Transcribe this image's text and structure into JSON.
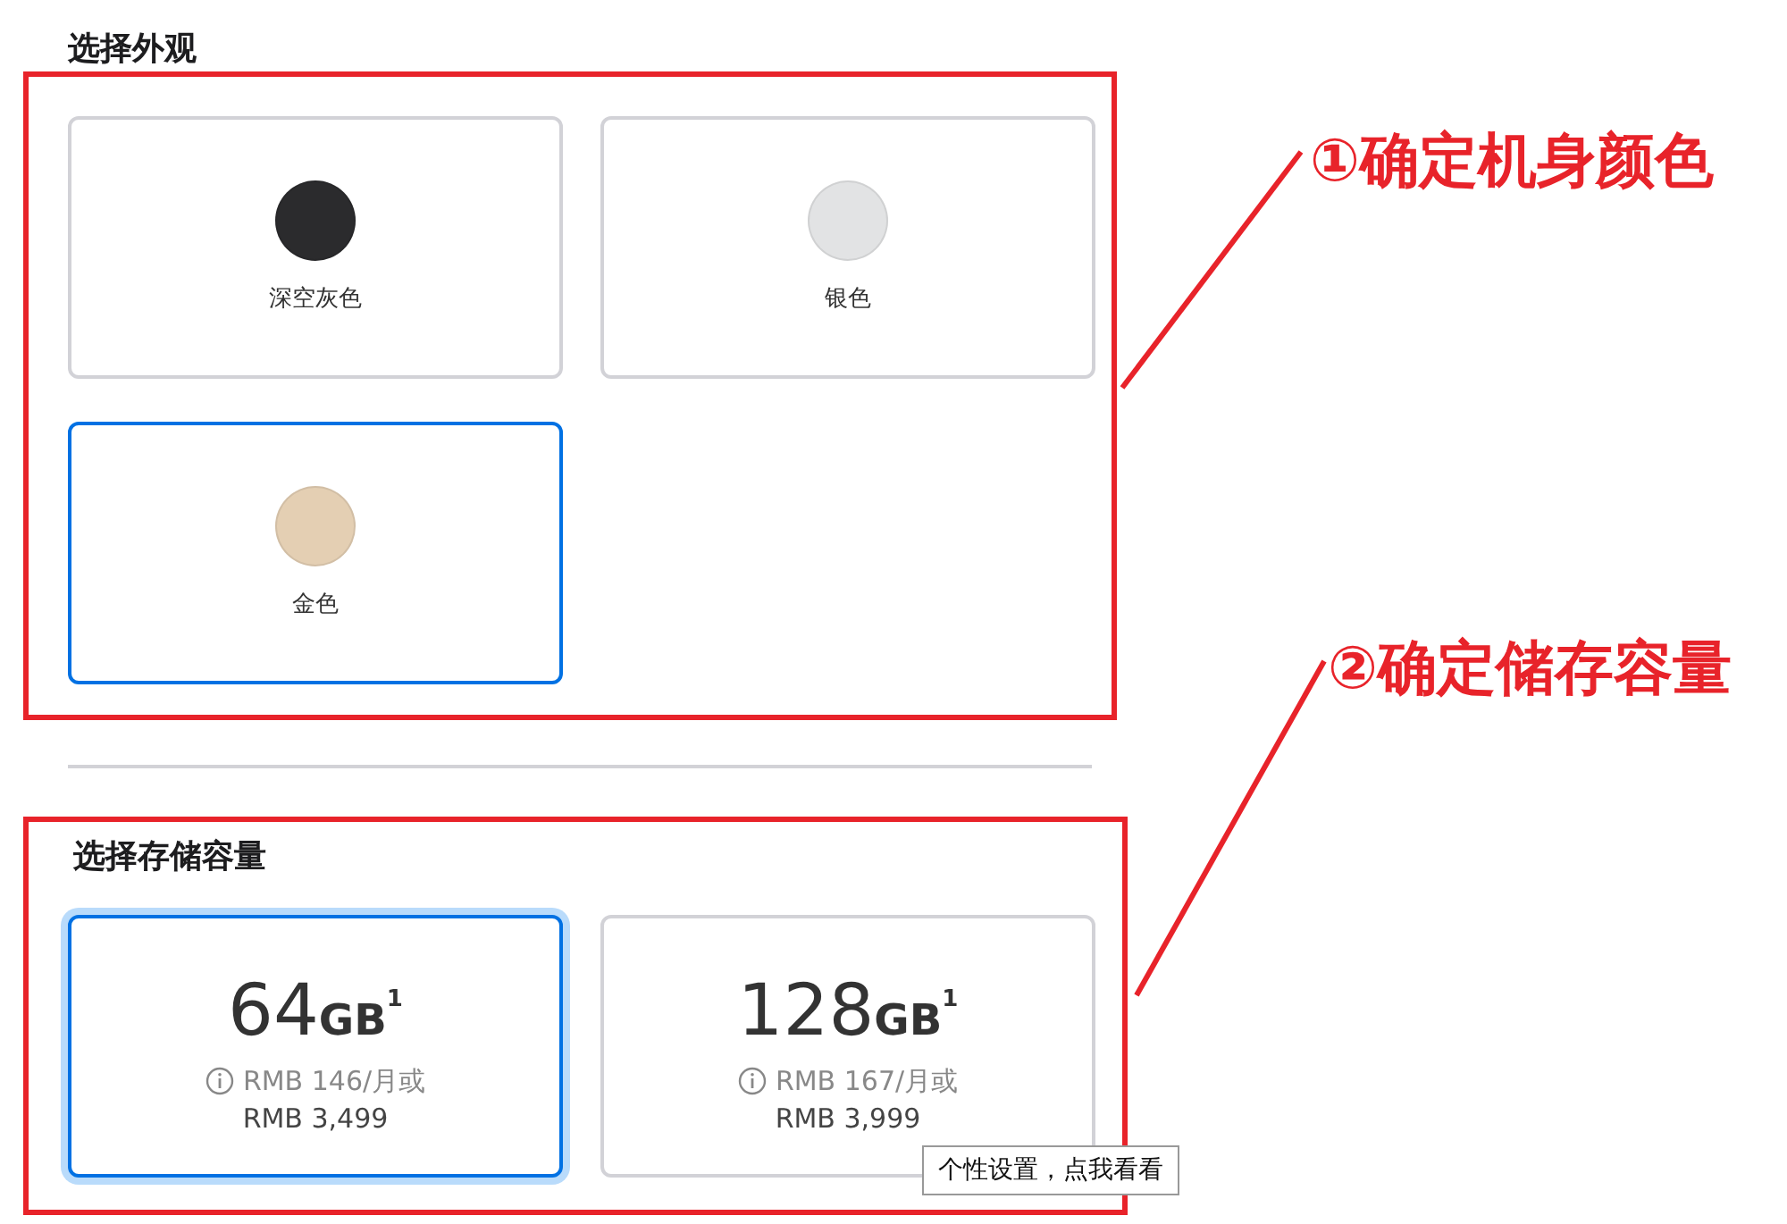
{
  "appearance": {
    "title": "选择外观",
    "options": [
      {
        "label": "深空灰色",
        "color": "#2b2b2d",
        "selected": false
      },
      {
        "label": "银色",
        "color": "#e2e3e4",
        "selected": false
      },
      {
        "label": "金色",
        "color": "#e4cfb3",
        "selected": true
      }
    ]
  },
  "storage": {
    "title": "选择存储容量",
    "options": [
      {
        "amount": "64",
        "unit": "GB",
        "note": "1",
        "monthly": "RMB 146/月或",
        "price": "RMB 3,499",
        "selected": true
      },
      {
        "amount": "128",
        "unit": "GB",
        "note": "1",
        "monthly": "RMB 167/月或",
        "price": "RMB 3,999",
        "selected": false
      }
    ]
  },
  "callouts": [
    "①确定机身颜色",
    "②确定储存容量"
  ],
  "tooltip": "个性设置，点我看看"
}
